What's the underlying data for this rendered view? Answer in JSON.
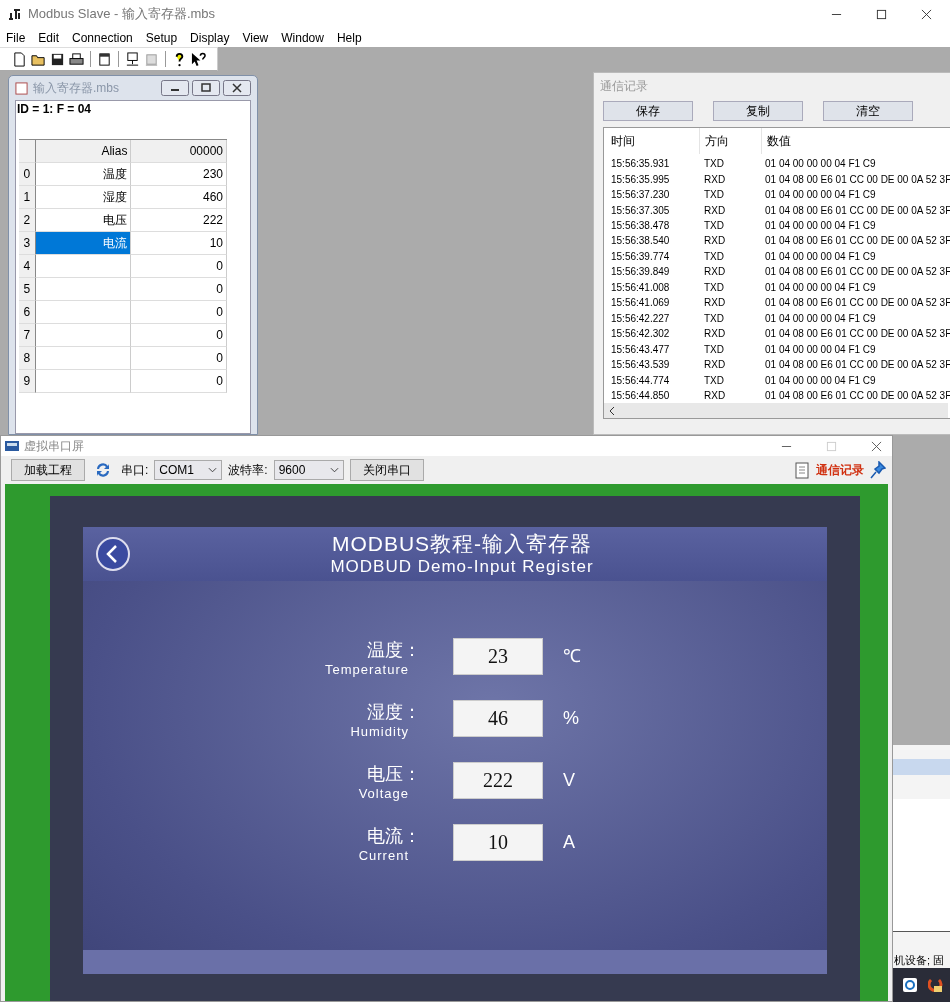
{
  "main_window": {
    "title": "Modbus Slave - 输入寄存器.mbs",
    "menu": [
      "File",
      "Edit",
      "Connection",
      "Setup",
      "Display",
      "View",
      "Window",
      "Help"
    ]
  },
  "child_window": {
    "title": "输入寄存器.mbs",
    "status": "ID = 1: F = 04",
    "columns": [
      "Alias",
      "00000"
    ],
    "rows": [
      {
        "index": "0",
        "alias": "温度",
        "value": "230",
        "selected": false
      },
      {
        "index": "1",
        "alias": "湿度",
        "value": "460",
        "selected": false
      },
      {
        "index": "2",
        "alias": "电压",
        "value": "222",
        "selected": false
      },
      {
        "index": "3",
        "alias": "电流",
        "value": "10",
        "selected": true
      },
      {
        "index": "4",
        "alias": "",
        "value": "0",
        "selected": false
      },
      {
        "index": "5",
        "alias": "",
        "value": "0",
        "selected": false
      },
      {
        "index": "6",
        "alias": "",
        "value": "0",
        "selected": false
      },
      {
        "index": "7",
        "alias": "",
        "value": "0",
        "selected": false
      },
      {
        "index": "8",
        "alias": "",
        "value": "0",
        "selected": false
      },
      {
        "index": "9",
        "alias": "",
        "value": "0",
        "selected": false
      }
    ]
  },
  "comm_log": {
    "title": "通信记录",
    "buttons": [
      "保存",
      "复制",
      "清空"
    ],
    "columns": [
      "时间",
      "方向",
      "数值"
    ],
    "rows": [
      {
        "time": "15:56:35.931",
        "direction": "TXD",
        "data": "01 04 00 00 00 04 F1 C9"
      },
      {
        "time": "15:56:35.995",
        "direction": "RXD",
        "data": "01 04 08 00 E6 01 CC 00 DE 00 0A 52 3F"
      },
      {
        "time": "15:56:37.230",
        "direction": "TXD",
        "data": "01 04 00 00 00 04 F1 C9"
      },
      {
        "time": "15:56:37.305",
        "direction": "RXD",
        "data": "01 04 08 00 E6 01 CC 00 DE 00 0A 52 3F"
      },
      {
        "time": "15:56:38.478",
        "direction": "TXD",
        "data": "01 04 00 00 00 04 F1 C9"
      },
      {
        "time": "15:56:38.540",
        "direction": "RXD",
        "data": "01 04 08 00 E6 01 CC 00 DE 00 0A 52 3F"
      },
      {
        "time": "15:56:39.774",
        "direction": "TXD",
        "data": "01 04 00 00 00 04 F1 C9"
      },
      {
        "time": "15:56:39.849",
        "direction": "RXD",
        "data": "01 04 08 00 E6 01 CC 00 DE 00 0A 52 3F"
      },
      {
        "time": "15:56:41.008",
        "direction": "TXD",
        "data": "01 04 00 00 00 04 F1 C9"
      },
      {
        "time": "15:56:41.069",
        "direction": "RXD",
        "data": "01 04 08 00 E6 01 CC 00 DE 00 0A 52 3F"
      },
      {
        "time": "15:56:42.227",
        "direction": "TXD",
        "data": "01 04 00 00 00 04 F1 C9"
      },
      {
        "time": "15:56:42.302",
        "direction": "RXD",
        "data": "01 04 08 00 E6 01 CC 00 DE 00 0A 52 3F"
      },
      {
        "time": "15:56:43.477",
        "direction": "TXD",
        "data": "01 04 00 00 00 04 F1 C9"
      },
      {
        "time": "15:56:43.539",
        "direction": "RXD",
        "data": "01 04 08 00 E6 01 CC 00 DE 00 0A 52 3F"
      },
      {
        "time": "15:56:44.774",
        "direction": "TXD",
        "data": "01 04 00 00 00 04 F1 C9"
      },
      {
        "time": "15:56:44.850",
        "direction": "RXD",
        "data": "01 04 08 00 E6 01 CC 00 DE 00 0A 52 3F"
      }
    ]
  },
  "serial_screen": {
    "title": "虚拟串口屏",
    "load_button": "加载工程",
    "port_label": "串口:",
    "port": "COM1",
    "baud_label": "波特率:",
    "baud": "9600",
    "close_port_button": "关闭串口",
    "log_link": "通信记录",
    "hmi": {
      "title": "MODBUS教程-输入寄存器",
      "subtitle": "MODBUD Demo-Input Register",
      "fields": [
        {
          "label": "温度：",
          "sublabel": "Temperature",
          "value": "23",
          "unit": "℃"
        },
        {
          "label": "湿度：",
          "sublabel": "Humidity",
          "value": "46",
          "unit": "%"
        },
        {
          "label": "电压：",
          "sublabel": "Voltage",
          "value": "222",
          "unit": "V"
        },
        {
          "label": "电流：",
          "sublabel": "Current",
          "value": "10",
          "unit": "A"
        }
      ]
    }
  },
  "background_window": {
    "text": "机设备; 固"
  }
}
